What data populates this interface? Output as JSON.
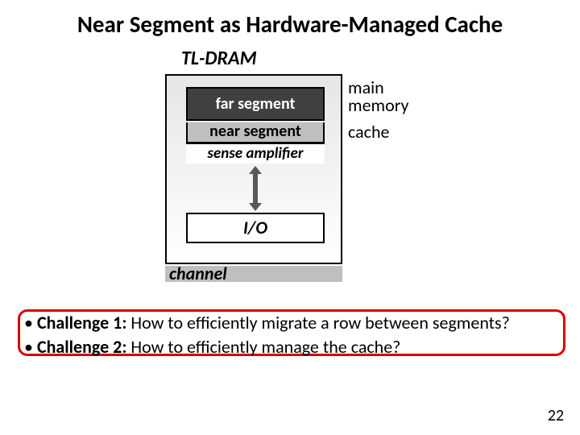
{
  "title": "Near Segment as Hardware-Managed Cache",
  "tldram_label": "TL-DRAM",
  "diagram": {
    "far": "far segment",
    "near": "near segment",
    "sense": "sense amplifier",
    "io": "I/O",
    "channel": "channel"
  },
  "side": {
    "main_line1": "main",
    "main_line2": "memory",
    "cache": "cache"
  },
  "bullets": {
    "c1_label": "Challenge 1:",
    "c1_text": " How to efficiently migrate a row between segments?",
    "c2_label": "Challenge 2:",
    "c2_text": " How to efficiently manage the cache?"
  },
  "page_number": "22"
}
